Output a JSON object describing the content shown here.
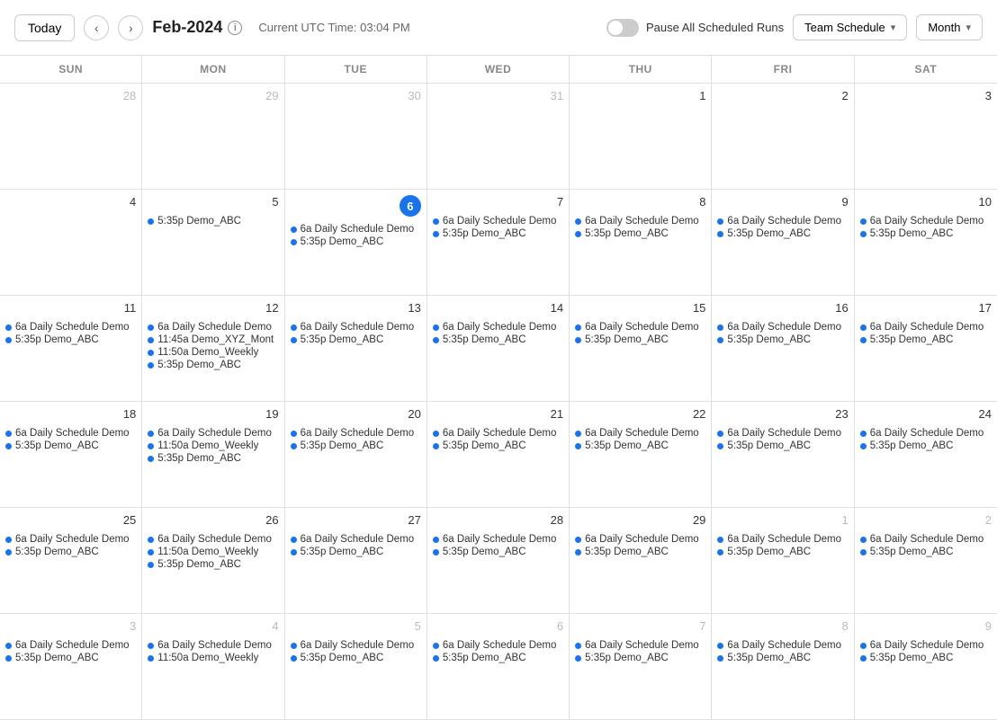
{
  "header": {
    "today_label": "Today",
    "month_title": "Feb-2024",
    "utc_time": "Current UTC Time: 03:04 PM",
    "pause_label": "Pause All Scheduled Runs",
    "team_schedule_label": "Team Schedule",
    "month_label": "Month"
  },
  "day_headers": [
    "SUN",
    "MON",
    "TUE",
    "WED",
    "THU",
    "FRI",
    "SAT"
  ],
  "weeks": [
    {
      "days": [
        {
          "date": "28",
          "other": true,
          "events": []
        },
        {
          "date": "29",
          "other": true,
          "events": []
        },
        {
          "date": "30",
          "other": true,
          "events": []
        },
        {
          "date": "31",
          "other": true,
          "events": []
        },
        {
          "date": "1",
          "events": []
        },
        {
          "date": "2",
          "events": []
        },
        {
          "date": "3",
          "events": []
        }
      ]
    },
    {
      "days": [
        {
          "date": "4",
          "events": []
        },
        {
          "date": "5",
          "events": [
            {
              "time": "5:35p",
              "name": "Demo_ABC",
              "dot": "blue"
            }
          ]
        },
        {
          "date": "6",
          "today": true,
          "events": [
            {
              "time": "6a",
              "name": "Daily Schedule Demo",
              "dot": "blue"
            },
            {
              "time": "5:35p",
              "name": "Demo_ABC",
              "dot": "blue"
            }
          ]
        },
        {
          "date": "7",
          "events": [
            {
              "time": "6a",
              "name": "Daily Schedule Demo",
              "dot": "blue"
            },
            {
              "time": "5:35p",
              "name": "Demo_ABC",
              "dot": "blue"
            }
          ]
        },
        {
          "date": "8",
          "events": [
            {
              "time": "6a",
              "name": "Daily Schedule Demo",
              "dot": "blue"
            },
            {
              "time": "5:35p",
              "name": "Demo_ABC",
              "dot": "blue"
            }
          ]
        },
        {
          "date": "9",
          "events": [
            {
              "time": "6a",
              "name": "Daily Schedule Demo",
              "dot": "blue"
            },
            {
              "time": "5:35p",
              "name": "Demo_ABC",
              "dot": "blue"
            }
          ]
        },
        {
          "date": "10",
          "events": [
            {
              "time": "6a",
              "name": "Daily Schedule Demo",
              "dot": "blue"
            },
            {
              "time": "5:35p",
              "name": "Demo_ABC",
              "dot": "blue"
            }
          ]
        }
      ]
    },
    {
      "days": [
        {
          "date": "11",
          "events": [
            {
              "time": "6a",
              "name": "Daily Schedule Demo",
              "dot": "blue"
            },
            {
              "time": "5:35p",
              "name": "Demo_ABC",
              "dot": "blue"
            }
          ]
        },
        {
          "date": "12",
          "events": [
            {
              "time": "6a",
              "name": "Daily Schedule Demo",
              "dot": "blue"
            },
            {
              "time": "11:45a",
              "name": "Demo_XYZ_Mont",
              "dot": "blue"
            },
            {
              "time": "11:50a",
              "name": "Demo_Weekly",
              "dot": "blue"
            },
            {
              "time": "5:35p",
              "name": "Demo_ABC",
              "dot": "blue"
            }
          ]
        },
        {
          "date": "13",
          "events": [
            {
              "time": "6a",
              "name": "Daily Schedule Demo",
              "dot": "blue"
            },
            {
              "time": "5:35p",
              "name": "Demo_ABC",
              "dot": "blue"
            }
          ]
        },
        {
          "date": "14",
          "events": [
            {
              "time": "6a",
              "name": "Daily Schedule Demo",
              "dot": "blue"
            },
            {
              "time": "5:35p",
              "name": "Demo_ABC",
              "dot": "blue"
            }
          ]
        },
        {
          "date": "15",
          "events": [
            {
              "time": "6a",
              "name": "Daily Schedule Demo",
              "dot": "blue"
            },
            {
              "time": "5:35p",
              "name": "Demo_ABC",
              "dot": "blue"
            }
          ]
        },
        {
          "date": "16",
          "events": [
            {
              "time": "6a",
              "name": "Daily Schedule Demo",
              "dot": "blue"
            },
            {
              "time": "5:35p",
              "name": "Demo_ABC",
              "dot": "blue"
            }
          ]
        },
        {
          "date": "17",
          "events": [
            {
              "time": "6a",
              "name": "Daily Schedule Demo",
              "dot": "blue"
            },
            {
              "time": "5:35p",
              "name": "Demo_ABC",
              "dot": "blue"
            }
          ]
        }
      ]
    },
    {
      "days": [
        {
          "date": "18",
          "events": [
            {
              "time": "6a",
              "name": "Daily Schedule Demo",
              "dot": "blue"
            },
            {
              "time": "5:35p",
              "name": "Demo_ABC",
              "dot": "blue"
            }
          ]
        },
        {
          "date": "19",
          "events": [
            {
              "time": "6a",
              "name": "Daily Schedule Demo",
              "dot": "blue"
            },
            {
              "time": "11:50a",
              "name": "Demo_Weekly",
              "dot": "blue"
            },
            {
              "time": "5:35p",
              "name": "Demo_ABC",
              "dot": "blue"
            }
          ]
        },
        {
          "date": "20",
          "events": [
            {
              "time": "6a",
              "name": "Daily Schedule Demo",
              "dot": "blue"
            },
            {
              "time": "5:35p",
              "name": "Demo_ABC",
              "dot": "blue"
            }
          ]
        },
        {
          "date": "21",
          "events": [
            {
              "time": "6a",
              "name": "Daily Schedule Demo",
              "dot": "blue"
            },
            {
              "time": "5:35p",
              "name": "Demo_ABC",
              "dot": "blue"
            }
          ]
        },
        {
          "date": "22",
          "events": [
            {
              "time": "6a",
              "name": "Daily Schedule Demo",
              "dot": "blue"
            },
            {
              "time": "5:35p",
              "name": "Demo_ABC",
              "dot": "blue"
            }
          ]
        },
        {
          "date": "23",
          "events": [
            {
              "time": "6a",
              "name": "Daily Schedule Demo",
              "dot": "blue"
            },
            {
              "time": "5:35p",
              "name": "Demo_ABC",
              "dot": "blue"
            }
          ]
        },
        {
          "date": "24",
          "events": [
            {
              "time": "6a",
              "name": "Daily Schedule Demo",
              "dot": "blue"
            },
            {
              "time": "5:35p",
              "name": "Demo_ABC",
              "dot": "blue"
            }
          ]
        }
      ]
    },
    {
      "days": [
        {
          "date": "25",
          "events": [
            {
              "time": "6a",
              "name": "Daily Schedule Demo",
              "dot": "blue"
            },
            {
              "time": "5:35p",
              "name": "Demo_ABC",
              "dot": "blue"
            }
          ]
        },
        {
          "date": "26",
          "events": [
            {
              "time": "6a",
              "name": "Daily Schedule Demo",
              "dot": "blue"
            },
            {
              "time": "11:50a",
              "name": "Demo_Weekly",
              "dot": "blue"
            },
            {
              "time": "5:35p",
              "name": "Demo_ABC",
              "dot": "blue"
            }
          ]
        },
        {
          "date": "27",
          "events": [
            {
              "time": "6a",
              "name": "Daily Schedule Demo",
              "dot": "blue"
            },
            {
              "time": "5:35p",
              "name": "Demo_ABC",
              "dot": "blue"
            }
          ]
        },
        {
          "date": "28",
          "events": [
            {
              "time": "6a",
              "name": "Daily Schedule Demo",
              "dot": "blue"
            },
            {
              "time": "5:35p",
              "name": "Demo_ABC",
              "dot": "blue"
            }
          ]
        },
        {
          "date": "29",
          "events": [
            {
              "time": "6a",
              "name": "Daily Schedule Demo",
              "dot": "blue"
            },
            {
              "time": "5:35p",
              "name": "Demo_ABC",
              "dot": "blue"
            }
          ]
        },
        {
          "date": "1",
          "other": true,
          "events": [
            {
              "time": "6a",
              "name": "Daily Schedule Demo",
              "dot": "blue"
            },
            {
              "time": "5:35p",
              "name": "Demo_ABC",
              "dot": "blue"
            }
          ]
        },
        {
          "date": "2",
          "other": true,
          "events": [
            {
              "time": "6a",
              "name": "Daily Schedule Demo",
              "dot": "blue"
            },
            {
              "time": "5:35p",
              "name": "Demo_ABC",
              "dot": "blue"
            }
          ]
        }
      ]
    },
    {
      "days": [
        {
          "date": "3",
          "other": true,
          "events": [
            {
              "time": "6a",
              "name": "Daily Schedule Demo",
              "dot": "blue"
            },
            {
              "time": "5:35p",
              "name": "Demo_ABC",
              "dot": "blue"
            }
          ]
        },
        {
          "date": "4",
          "other": true,
          "events": [
            {
              "time": "6a",
              "name": "Daily Schedule Demo",
              "dot": "blue"
            },
            {
              "time": "11:50a",
              "name": "Demo_Weekly",
              "dot": "blue"
            }
          ]
        },
        {
          "date": "5",
          "other": true,
          "events": [
            {
              "time": "6a",
              "name": "Daily Schedule Demo",
              "dot": "blue"
            },
            {
              "time": "5:35p",
              "name": "Demo_ABC",
              "dot": "blue"
            }
          ]
        },
        {
          "date": "6",
          "other": true,
          "events": [
            {
              "time": "6a",
              "name": "Daily Schedule Demo",
              "dot": "blue"
            },
            {
              "time": "5:35p",
              "name": "Demo_ABC",
              "dot": "blue"
            }
          ]
        },
        {
          "date": "7",
          "other": true,
          "events": [
            {
              "time": "6a",
              "name": "Daily Schedule Demo",
              "dot": "blue"
            },
            {
              "time": "5:35p",
              "name": "Demo_ABC",
              "dot": "blue"
            }
          ]
        },
        {
          "date": "8",
          "other": true,
          "events": [
            {
              "time": "6a",
              "name": "Daily Schedule Demo",
              "dot": "blue"
            },
            {
              "time": "5:35p",
              "name": "Demo_ABC",
              "dot": "blue"
            }
          ]
        },
        {
          "date": "9",
          "other": true,
          "events": [
            {
              "time": "6a",
              "name": "Daily Schedule Demo",
              "dot": "blue"
            },
            {
              "time": "5:35p",
              "name": "Demo_ABC",
              "dot": "blue"
            }
          ]
        }
      ]
    }
  ]
}
